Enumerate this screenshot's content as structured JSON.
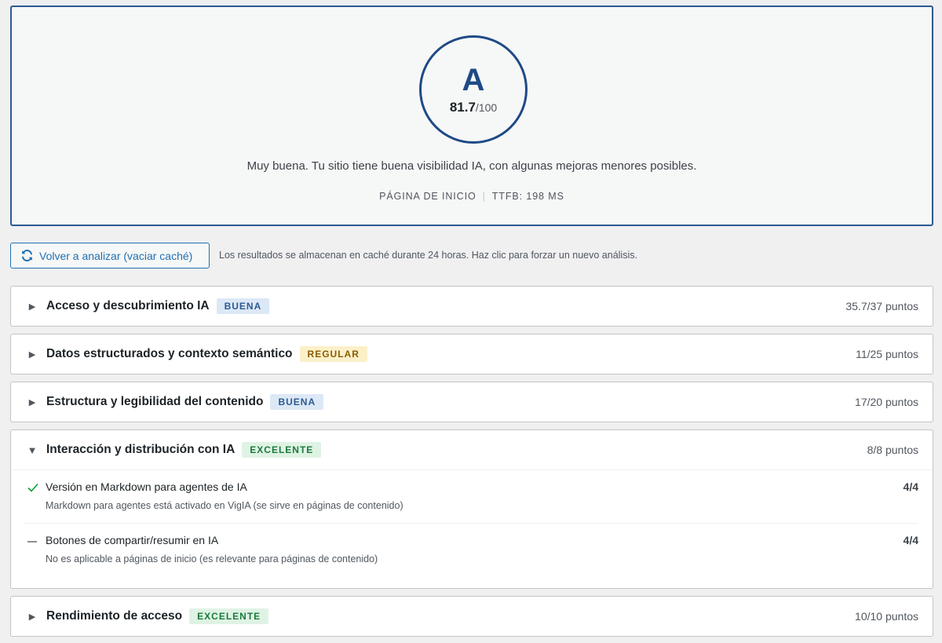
{
  "score": {
    "grade": "A",
    "value": "81.7",
    "max": "/100",
    "verdict": "Muy buena. Tu sitio tiene buena visibilidad IA, con algunas mejoras menores posibles.",
    "page_label": "PÁGINA DE INICIO",
    "ttfb_label": "TTFB: 198 MS"
  },
  "toolbar": {
    "reanalyze_label": "Volver a analizar (vaciar caché)",
    "cache_note": "Los resultados se almacenan en caché durante 24 horas. Haz clic para forzar un nuevo análisis."
  },
  "sections": [
    {
      "title": "Acceso y descubrimiento IA",
      "badge": "BUENA",
      "points": "35.7/37 puntos"
    },
    {
      "title": "Datos estructurados y contexto semántico",
      "badge": "REGULAR",
      "points": "11/25 puntos"
    },
    {
      "title": "Estructura y legibilidad del contenido",
      "badge": "BUENA",
      "points": "17/20 puntos"
    },
    {
      "title": "Interacción y distribución con IA",
      "badge": "EXCELENTE",
      "points": "8/8 puntos",
      "checks": [
        {
          "title": "Versión en Markdown para agentes de IA",
          "desc": "Markdown para agentes está activado en VigIA (se sirve en páginas de contenido)",
          "score": "4/4"
        },
        {
          "title": "Botones de compartir/resumir en IA",
          "desc": "No es aplicable a páginas de inicio (es relevante para páginas de contenido)",
          "score": "4/4"
        }
      ]
    },
    {
      "title": "Rendimiento de acceso",
      "badge": "EXCELENTE",
      "points": "10/10 puntos"
    }
  ],
  "icons": {
    "collapsed_caret": "▶",
    "expanded_caret": "▼"
  },
  "colors": {
    "accent": "#2271b1",
    "grade": "#1e4a86",
    "pass": "#00a32a"
  }
}
